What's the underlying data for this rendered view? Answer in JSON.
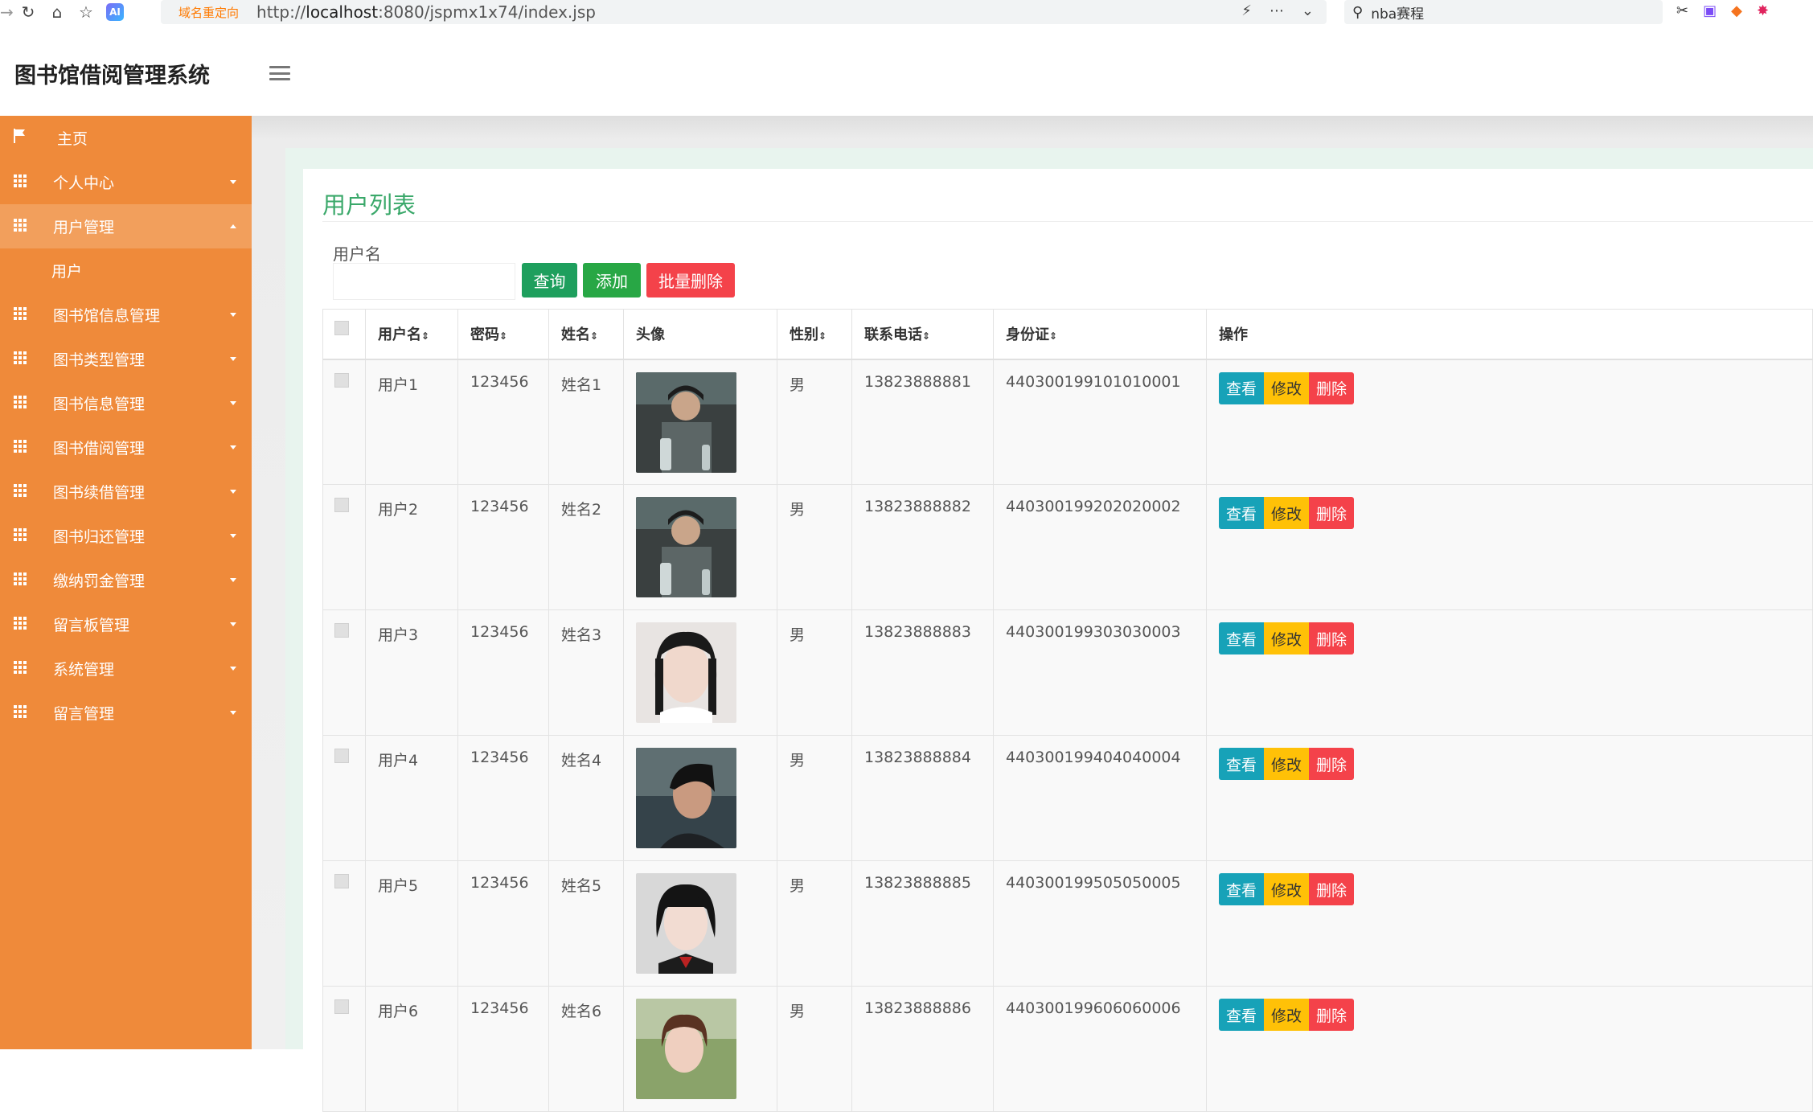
{
  "browser": {
    "redirect_label": "域名重定向",
    "url_prefix": "http://",
    "url_host": "localhost",
    "url_rest": ":8080/jspmx1x74/index.jsp",
    "search_text": "nba赛程"
  },
  "app": {
    "title": "图书馆借阅管理系统"
  },
  "sidebar": {
    "items": [
      {
        "label": "主页",
        "icon": "flag-icon"
      },
      {
        "label": "个人中心",
        "icon": "grid-icon"
      },
      {
        "label": "用户管理",
        "icon": "grid-icon",
        "expanded": true
      },
      {
        "label": "图书馆信息管理",
        "icon": "grid-icon"
      },
      {
        "label": "图书类型管理",
        "icon": "grid-icon"
      },
      {
        "label": "图书信息管理",
        "icon": "grid-icon"
      },
      {
        "label": "图书借阅管理",
        "icon": "grid-icon"
      },
      {
        "label": "图书续借管理",
        "icon": "grid-icon"
      },
      {
        "label": "图书归还管理",
        "icon": "grid-icon"
      },
      {
        "label": "缴纳罚金管理",
        "icon": "grid-icon"
      },
      {
        "label": "留言板管理",
        "icon": "grid-icon"
      },
      {
        "label": "系统管理",
        "icon": "grid-icon"
      },
      {
        "label": "留言管理",
        "icon": "grid-icon"
      }
    ],
    "sub_items": {
      "user": "用户"
    }
  },
  "panel": {
    "title": "用户列表",
    "search_label": "用户名",
    "search_value": "",
    "buttons": {
      "query": "查询",
      "add": "添加",
      "batch_delete": "批量删除"
    }
  },
  "table": {
    "headers": {
      "username": "用户名",
      "password": "密码",
      "name": "姓名",
      "avatar": "头像",
      "gender": "性别",
      "phone": "联系电话",
      "idcard": "身份证",
      "actions": "操作"
    },
    "rows": [
      {
        "username": "用户1",
        "password": "123456",
        "name": "姓名1",
        "gender": "男",
        "phone": "13823888881",
        "idcard": "440300199101010001"
      },
      {
        "username": "用户2",
        "password": "123456",
        "name": "姓名2",
        "gender": "男",
        "phone": "13823888882",
        "idcard": "440300199202020002"
      },
      {
        "username": "用户3",
        "password": "123456",
        "name": "姓名3",
        "gender": "男",
        "phone": "13823888883",
        "idcard": "440300199303030003"
      },
      {
        "username": "用户4",
        "password": "123456",
        "name": "姓名4",
        "gender": "男",
        "phone": "13823888884",
        "idcard": "440300199404040004"
      },
      {
        "username": "用户5",
        "password": "123456",
        "name": "姓名5",
        "gender": "男",
        "phone": "13823888885",
        "idcard": "440300199505050005"
      },
      {
        "username": "用户6",
        "password": "123456",
        "name": "姓名6",
        "gender": "男",
        "phone": "13823888886",
        "idcard": "440300199606060006"
      }
    ],
    "action_labels": {
      "view": "查看",
      "edit": "修改",
      "delete": "删除"
    }
  },
  "colors": {
    "sidebar": "#ef8a3a",
    "sidebar_active": "#f29f5c",
    "title_green": "#3aa86a",
    "view": "#17a2b8",
    "edit": "#ffc107",
    "delete": "#f4424a"
  }
}
